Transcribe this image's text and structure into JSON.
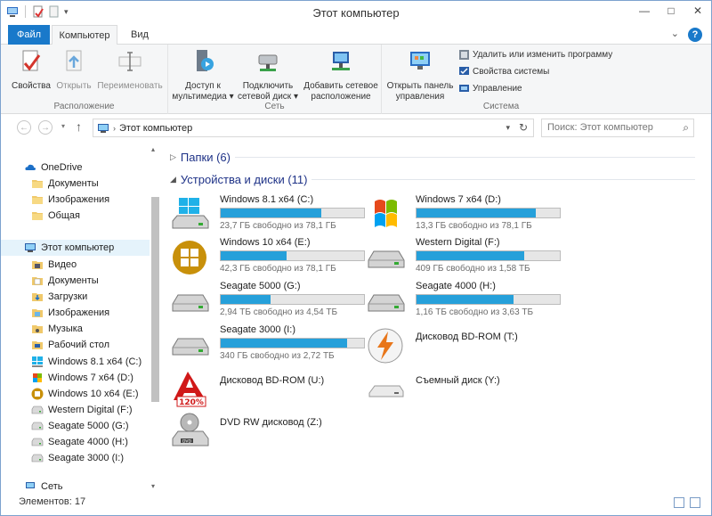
{
  "window": {
    "title": "Этот компьютер"
  },
  "tabs": {
    "file": "Файл",
    "computer": "Компьютер",
    "view": "Вид"
  },
  "ribbon": {
    "location": {
      "name": "Расположение",
      "properties": "Свойства",
      "open": "Открыть",
      "rename": "Переименовать"
    },
    "network": {
      "name": "Сеть",
      "media_line1": "Доступ к",
      "media_line2": "мультимедиа",
      "map_line1": "Подключить",
      "map_line2": "сетевой диск",
      "add_line1": "Добавить сетевое",
      "add_line2": "расположение"
    },
    "system": {
      "name": "Система",
      "cp_line1": "Открыть панель",
      "cp_line2": "управления",
      "uninstall": "Удалить или изменить программу",
      "sysprops": "Свойства системы",
      "manage": "Управление"
    }
  },
  "address": {
    "crumb": "Этот компьютер",
    "search_placeholder": "Поиск: Этот компьютер"
  },
  "nav": {
    "onedrive": "OneDrive",
    "od_docs": "Документы",
    "od_images": "Изображения",
    "od_shared": "Общая",
    "thispc": "Этот компьютер",
    "video": "Видео",
    "docs": "Документы",
    "downloads": "Загрузки",
    "images": "Изображения",
    "music": "Музыка",
    "desktop": "Рабочий стол",
    "c": "Windows 8.1 x64 (C:)",
    "d": "Windows 7 x64 (D:)",
    "e": "Windows 10 x64 (E:)",
    "f": "Western Digital (F:)",
    "g": "Seagate 5000 (G:)",
    "h": "Seagate 4000 (H:)",
    "i": "Seagate 3000 (I:)",
    "network": "Сеть"
  },
  "content": {
    "folders_header": "Папки (6)",
    "devices_header": "Устройства и диски (11)",
    "drives": [
      {
        "name": "Windows 8.1 x64 (C:)",
        "free": "23,7 ГБ свободно из 78,1 ГБ",
        "used_fraction": 0.7,
        "icon": "windows-8-drive-icon"
      },
      {
        "name": "Windows 7 x64 (D:)",
        "free": "13,3 ГБ свободно из 78,1 ГБ",
        "used_fraction": 0.83,
        "icon": "windows-7-drive-icon"
      },
      {
        "name": "Windows 10 x64 (E:)",
        "free": "42,3 ГБ свободно из 78,1 ГБ",
        "used_fraction": 0.46,
        "icon": "windows-10-drive-icon"
      },
      {
        "name": "Western Digital (F:)",
        "free": "409 ГБ свободно из 1,58 ТБ",
        "used_fraction": 0.75,
        "icon": "hard-drive-icon"
      },
      {
        "name": "Seagate 5000 (G:)",
        "free": "2,94 ТБ свободно из 4,54 ТБ",
        "used_fraction": 0.35,
        "icon": "hard-drive-icon"
      },
      {
        "name": "Seagate 4000 (H:)",
        "free": "1,16 ТБ свободно из 3,63 ТБ",
        "used_fraction": 0.68,
        "icon": "hard-drive-icon"
      },
      {
        "name": "Seagate 3000 (I:)",
        "free": "340 ГБ свободно из 2,72 ТБ",
        "used_fraction": 0.88,
        "icon": "hard-drive-icon"
      },
      {
        "name": "Дисковод BD-ROM (T:)",
        "icon": "daemon-tools-drive-icon"
      },
      {
        "name": "Дисковод BD-ROM (U:)",
        "icon": "alcohol-120-drive-icon"
      },
      {
        "name": "Съемный диск (Y:)",
        "icon": "removable-drive-icon"
      },
      {
        "name": "DVD RW дисковод (Z:)",
        "icon": "dvd-drive-icon"
      }
    ]
  },
  "status": {
    "items": "Элементов: 17"
  },
  "colors": {
    "accent": "#1979ca",
    "bar_fill": "#26a0da",
    "selection": "#e5f3fb"
  }
}
